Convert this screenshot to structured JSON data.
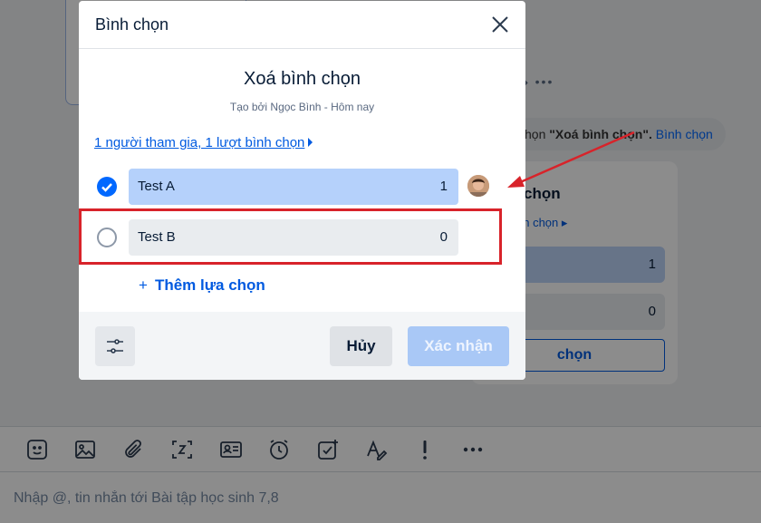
{
  "background": {
    "message": {
      "prefix": "họn ",
      "quoted": "\"Xoá bình chọn\".",
      "link": "Bình chọn"
    },
    "poll_card": {
      "title_fragment": "chọn",
      "stats_fragment": "nh chọn ▸",
      "option1_count": "1",
      "option2_count": "0",
      "button_fragment": "chọn"
    },
    "mini_actions": "◆ •••"
  },
  "toolbar": {
    "items": [
      "sticker-icon",
      "image-icon",
      "attachment-icon",
      "screenshot-icon",
      "contact-card-icon",
      "reminder-icon",
      "task-icon",
      "format-text-icon",
      "urgent-icon",
      "more-icon"
    ]
  },
  "composer": {
    "placeholder": "Nhập @, tin nhắn tới Bài tập học sinh 7,8"
  },
  "modal": {
    "header_title": "Bình chọn",
    "poll_title": "Xoá bình chọn",
    "meta": "Tạo bởi Ngọc Bình - Hôm nay",
    "stats": "1 người tham gia, 1 lượt bình chọn",
    "options": [
      {
        "label": "Test A",
        "count": "1",
        "selected": true
      },
      {
        "label": "Test B",
        "count": "0",
        "selected": false
      }
    ],
    "add_option": "Thêm lựa chọn",
    "add_option_symbol": "+",
    "cancel": "Hủy",
    "confirm": "Xác nhận"
  },
  "colors": {
    "accent": "#0068ff",
    "selected_bar": "#b5d1fb",
    "annotation": "#d8232a"
  }
}
